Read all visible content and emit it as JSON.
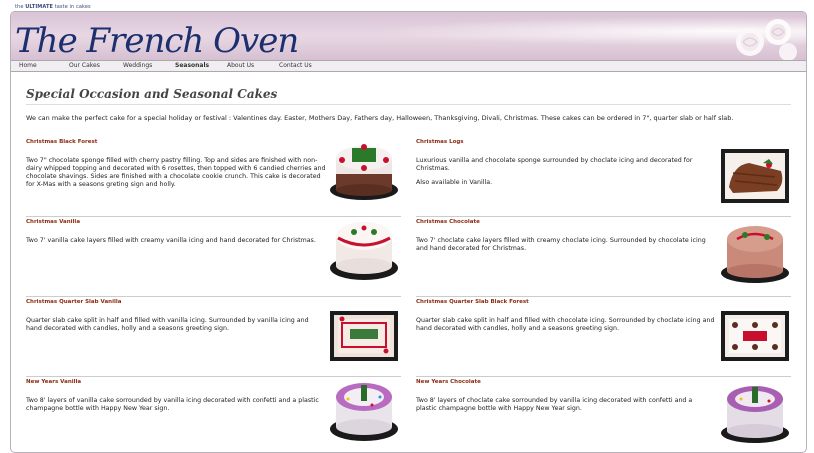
{
  "site": {
    "tagline_prefix": "the",
    "tagline_bold": "ULTIMATE",
    "tagline_suffix": "taste in cakes",
    "logo": "The French Oven"
  },
  "nav": {
    "items": [
      "Home",
      "Our Cakes",
      "Weddings",
      "Seasonals",
      "About Us",
      "Contact Us"
    ],
    "active": "Seasonals"
  },
  "page": {
    "title": "Special Occasion and Seasonal Cakes",
    "intro": "We can make the perfect cake for a special holiday or festival : Valentines day. Easter, Mothers Day, Fathers day, Halloween, Thanksgiving, Divali, Christmas. These cakes can be ordered in 7\", quarter slab or half slab."
  },
  "cakes": [
    {
      "title": "Christmas Black Forest",
      "desc": [
        "Two 7\" chocolate sponge filled with cherry pastry filling. Top and sides are finished with non-dairy whipped topping and decorated with 6 rosettes, then topped with 6 candied cherries and chocolate shavings. Sides are finished with a chocolate cookie crunch. This cake is decorated for X-Mas with a seasons greting sign and holly."
      ],
      "image_icon": "round-cake-white-red"
    },
    {
      "title": "Christmas Logs",
      "desc": [
        "Luxurious vanilla and chocolate sponge surrounded by choclate icing and decorated for Christmas.",
        "Also available in Vanilla."
      ],
      "image_icon": "log-cake"
    },
    {
      "title": "Christmas Vanilla",
      "desc": [
        "Two 7' vanilla cake layers filled with creamy vanilla icing and hand decorated for Christmas."
      ],
      "image_icon": "round-cake-white-red"
    },
    {
      "title": "Christmas Chocolate",
      "desc": [
        "Two 7' choclate cake layers filled with creamy choclate icing. Surrounded by chocolate icing and hand decorated for Christmas."
      ],
      "image_icon": "round-cake-brown-red"
    },
    {
      "title": "Christmas Quarter Slab Vanilla",
      "desc": [
        "Quarter slab cake split in half and filled with vanilla icing. Surrounded by vanilla icing and hand decorated with candles, holly and a seasons greeting sign."
      ],
      "image_icon": "slab-cake-white"
    },
    {
      "title": "Christmas Quarter Slab Black Forest",
      "desc": [
        "Quarter slab cake split in half and filled with chocolate icing. Sorrounded by choclate icing and hand decorated with candles, holly and a seasons greeting sign."
      ],
      "image_icon": "slab-cake-brown"
    },
    {
      "title": "New Years Vanilla",
      "desc": [
        "Two 8' layers of vanilla cake sorrounded by vanilla icing decorated with confetti and a plastic champagne bottle with Happy New Year sign."
      ],
      "image_icon": "round-cake-purple"
    },
    {
      "title": "New Years Chocolate",
      "desc": [
        "Two 8' layers of choclate cake sorrounded by vanilla icing decorated with confetti and a plastic champagne bottle with Happy New Year sign."
      ],
      "image_icon": "round-cake-purple"
    }
  ],
  "colors": {
    "logo": "#1c2f6e",
    "cake_title": "#8b2a10",
    "banner": "#dcc6d9"
  }
}
